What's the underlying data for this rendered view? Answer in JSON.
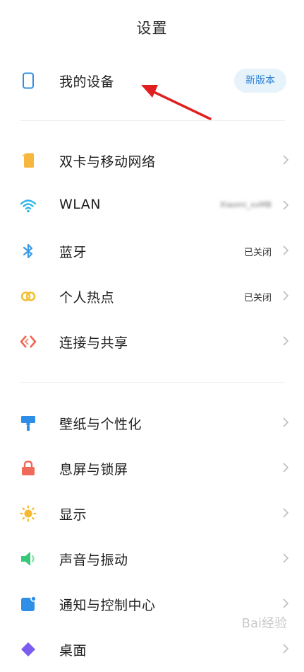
{
  "header": {
    "title": "设置"
  },
  "device": {
    "label": "我的设备",
    "badge": "新版本"
  },
  "group1": [
    {
      "label": "双卡与移动网络",
      "status": ""
    },
    {
      "label": "WLAN",
      "status": "Xiaomi_xxMB"
    },
    {
      "label": "蓝牙",
      "status": "已关闭"
    },
    {
      "label": "个人热点",
      "status": "已关闭"
    },
    {
      "label": "连接与共享",
      "status": ""
    }
  ],
  "group2": [
    {
      "label": "壁纸与个性化"
    },
    {
      "label": "息屏与锁屏"
    },
    {
      "label": "显示"
    },
    {
      "label": "声音与振动"
    },
    {
      "label": "通知与控制中心"
    },
    {
      "label": "桌面"
    }
  ],
  "watermark": "Bai经验",
  "colors": {
    "device_icon": "#2f8fe0",
    "sim_icon": "#f6b73c",
    "wlan_icon": "#2fb5e8",
    "bluetooth_icon": "#3a9be6",
    "hotspot_icon": "#f3c033",
    "share_icon": "#f0674f",
    "wallpaper_icon": "#2e8de6",
    "lock_icon": "#f06a5a",
    "display_icon": "#f5b82e",
    "sound_icon": "#35c978",
    "notify_icon": "#2f8fe6",
    "arrow": "#e02020"
  }
}
